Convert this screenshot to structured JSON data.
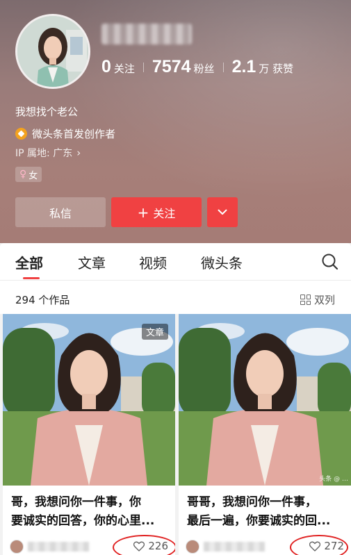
{
  "profile": {
    "stats": [
      {
        "num": "0",
        "label": "关注"
      },
      {
        "num": "7574",
        "label": "粉丝"
      },
      {
        "num": "2.1",
        "label": "万 获赞"
      }
    ],
    "bio": "我想找个老公",
    "creator_label": "微头条首发创作者",
    "ip_label": "IP 属地: 广东",
    "gender": "女",
    "gender_icon": "female-icon",
    "buttons": {
      "message": "私信",
      "follow_plus": "+",
      "follow": "关注",
      "more_icon": "chevron-down-icon"
    }
  },
  "tabs": [
    "全部",
    "文章",
    "视频",
    "微头条"
  ],
  "works": {
    "count_label": "294 个作品",
    "layout_label": "双列"
  },
  "cards": [
    {
      "tag": "文章",
      "title_lines": [
        "哥，我想问你一件事，你",
        "要诚实的回答，你的心里..."
      ],
      "likes": "226"
    },
    {
      "watermark": "头条 @ …",
      "title_lines": [
        "哥哥，我想问你一件事，",
        "最后一遍，你要诚实的回..."
      ],
      "likes": "272"
    }
  ],
  "colors": {
    "accent": "#f04142",
    "creator_badge": "#f3a21e",
    "annotation": "#e02020"
  }
}
